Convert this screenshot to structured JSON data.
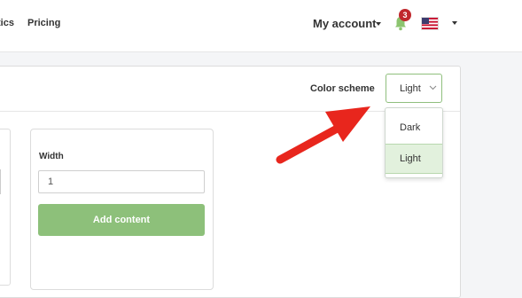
{
  "nav": {
    "items": [
      {
        "label": "tics"
      },
      {
        "label": "Pricing"
      }
    ]
  },
  "account": {
    "label": "My account",
    "notification_count": "3",
    "bell_icon": "bell-icon",
    "flag_icon": "us-flag-icon"
  },
  "settings": {
    "color_scheme_label": "Color scheme",
    "selected": "Light",
    "options": [
      "Dark",
      "Light"
    ]
  },
  "card": {
    "width_label": "Width",
    "width_value": "1",
    "add_button": "Add content"
  },
  "colors": {
    "accent_green": "#8dc07a",
    "badge_red": "#c0272d",
    "arrow_red": "#e8261d"
  }
}
